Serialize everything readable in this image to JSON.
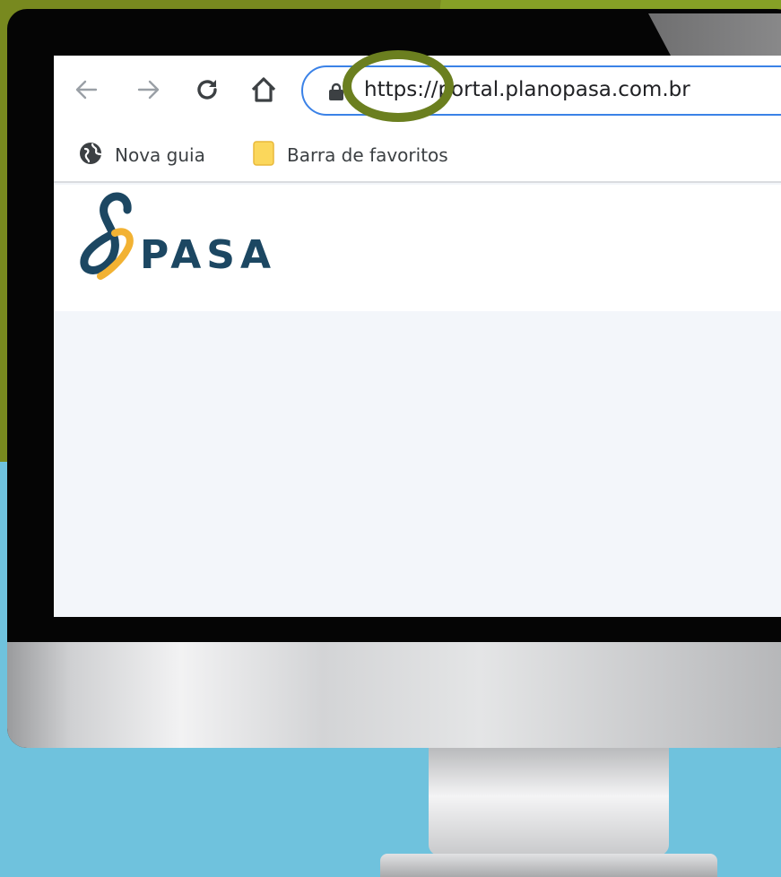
{
  "browser": {
    "url": {
      "scheme": "https://",
      "host": "portal.planopasa.com.br"
    },
    "bookmarks": [
      {
        "label": "Nova guia",
        "icon": "globe-icon"
      },
      {
        "label": "Barra de favoritos",
        "icon": "folder-icon"
      }
    ]
  },
  "site": {
    "logo_text": "PASA"
  },
  "colors": {
    "accent_olive": "#78891f",
    "background_blue": "#6fc2dd",
    "logo_navy": "#1c4762",
    "logo_gold": "#f2b233",
    "omnibox_border": "#3b82e7",
    "highlight_ring": "#6b7f1f"
  }
}
